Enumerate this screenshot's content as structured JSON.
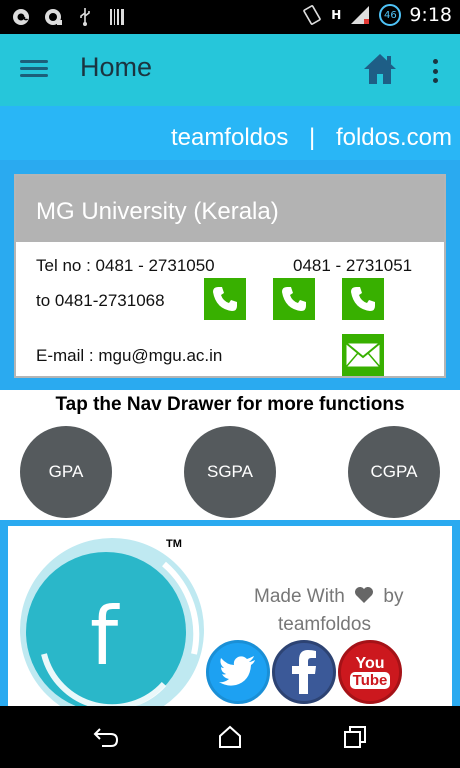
{
  "status_bar": {
    "time": "9:18",
    "network": "H",
    "battery_badge": "46",
    "icons": [
      "at-icon",
      "record-icon",
      "usb-icon",
      "barcode-icon",
      "rotate-icon",
      "signal-icon"
    ]
  },
  "app_bar": {
    "title": "Home",
    "icons": [
      "hamburger-menu-icon",
      "home-icon",
      "more-vert-icon"
    ]
  },
  "banner": {
    "left": "teamfoldos",
    "separator": "|",
    "right": "foldos.com"
  },
  "contact_card": {
    "title": "MG University (Kerala)",
    "tel_label": "Tel no : 0481 - 2731050",
    "tel_second": "0481 - 2731051",
    "tel_range": "to  0481-2731068",
    "email_label": "E-mail : mgu@mgu.ac.in",
    "call_buttons": 3
  },
  "hint": "Tap the Nav Drawer for more functions",
  "calculators": [
    {
      "label": "GPA"
    },
    {
      "label": "SGPA"
    },
    {
      "label": "CGPA"
    }
  ],
  "footer": {
    "tm": "TM",
    "made_with": "Made With",
    "by": "by",
    "team": "teamfoldos",
    "social": [
      "twitter-icon",
      "facebook-icon",
      "youtube-icon"
    ],
    "youtube_top": "You",
    "youtube_bottom": "Tube"
  },
  "colors": {
    "app_bar": "#26c6da",
    "banner": "#29b6f6",
    "section": "#2aaaf0",
    "call_button": "#38b000",
    "calc_button": "#555a5d"
  }
}
